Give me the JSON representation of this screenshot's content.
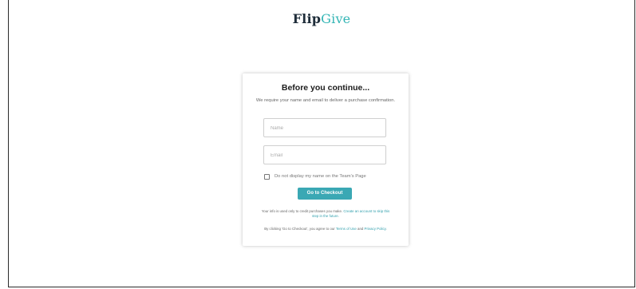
{
  "brand": {
    "part1": "Flip",
    "part2": "Give"
  },
  "modal": {
    "title": "Before you continue...",
    "subtitle": "We require your name and email to deliver a purchase confirmation.",
    "name_placeholder": "Name",
    "email_placeholder": "Email",
    "checkbox_label": "Do not display my name on the Team's Page",
    "checkbox_checked": false,
    "button_label": "Go to Checkout",
    "note1_text": "Your info is used only to credit purchases you make. ",
    "note1_link": "Create an account to skip this step in the future.",
    "note2_text": "By clicking 'Go to Checkout', you agree to our ",
    "note2_link1": "Terms of Use",
    "note2_and": " and ",
    "note2_link2": "Privacy Policy",
    "note2_end": "."
  },
  "colors": {
    "accent": "#3aa8b4",
    "brand_dark": "#1f2d3a",
    "brand_teal": "#33b5b5"
  }
}
